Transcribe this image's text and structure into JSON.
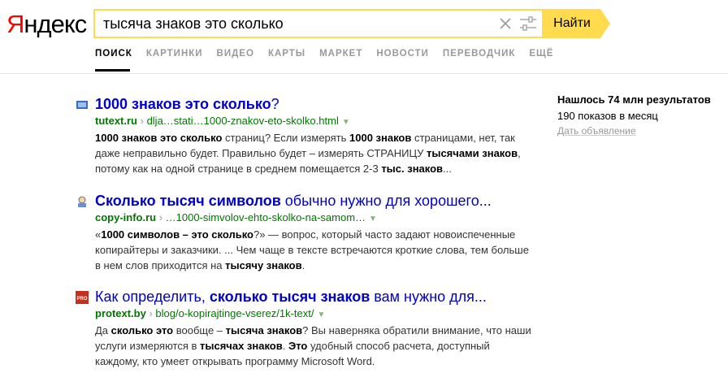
{
  "header": {
    "logo_first": "Я",
    "logo_rest": "ндекс",
    "search_value": "тысяча знаков это сколько",
    "search_button": "Найти"
  },
  "tabs": [
    "ПОИСК",
    "КАРТИНКИ",
    "ВИДЕО",
    "КАРТЫ",
    "МАРКЕТ",
    "НОВОСТИ",
    "ПЕРЕВОДЧИК",
    "ЕЩЁ"
  ],
  "results": [
    {
      "title_segments": [
        {
          "t": "1000 знаков это сколько",
          "b": true
        },
        {
          "t": "?",
          "b": false
        }
      ],
      "host": "tutext.ru",
      "path": "dlja…stati…1000-znakov-eto-skolko.html",
      "snippet_segments": [
        {
          "t": "1000 знаков это сколько",
          "b": true
        },
        {
          "t": " страниц? Если измерять ",
          "b": false
        },
        {
          "t": "1000 знаков",
          "b": true
        },
        {
          "t": " страницами, нет, так даже неправильно будет. Правильно будет – измерять СТРАНИЦУ ",
          "b": false
        },
        {
          "t": "тысячами знаков",
          "b": true
        },
        {
          "t": ", потому как на одной странице в среднем помещается 2-3 ",
          "b": false
        },
        {
          "t": "тыс. знаков",
          "b": true
        },
        {
          "t": "...",
          "b": false
        }
      ]
    },
    {
      "title_segments": [
        {
          "t": "Сколько тысяч символов",
          "b": true
        },
        {
          "t": " обычно нужно для хорошего...",
          "b": false
        }
      ],
      "host": "copy-info.ru",
      "path": "…1000-simvolov-ehto-skolko-na-samom…",
      "snippet_segments": [
        {
          "t": "«",
          "b": false
        },
        {
          "t": "1000 символов – это сколько",
          "b": true
        },
        {
          "t": "?» — вопрос, который часто задают новоиспеченные копирайтеры и заказчики. ... Чем чаще в тексте встречаются кроткие слова, тем больше в нем слов приходится на ",
          "b": false
        },
        {
          "t": "тысячу знаков",
          "b": true
        },
        {
          "t": ".",
          "b": false
        }
      ]
    },
    {
      "title_segments": [
        {
          "t": "Как определить, ",
          "b": false
        },
        {
          "t": "сколько тысяч знаков",
          "b": true
        },
        {
          "t": " вам нужно для...",
          "b": false
        }
      ],
      "host": "protext.by",
      "path": "blog/o-kopirajtinge-vserez/1k-text/",
      "snippet_segments": [
        {
          "t": "Да ",
          "b": false
        },
        {
          "t": "сколько это",
          "b": true
        },
        {
          "t": " вообще – ",
          "b": false
        },
        {
          "t": "тысяча знаков",
          "b": true
        },
        {
          "t": "? Вы наверняка обратили внимание, что наши услуги измеряются в ",
          "b": false
        },
        {
          "t": "тысячах знаков",
          "b": true
        },
        {
          "t": ". ",
          "b": false
        },
        {
          "t": "Это",
          "b": true
        },
        {
          "t": " удобный способ расчета, доступный каждому, кто умеет открывать программу Microsoft Word.",
          "b": false
        }
      ]
    }
  ],
  "sidebar": {
    "found": "Нашлось 74 млн результатов",
    "shows": "190 показов в месяц",
    "ad": "Дать объявление"
  },
  "colors": {
    "accent": "#ffdb4d",
    "link": "#0000cc",
    "url": "#007700"
  },
  "icons": [
    "clear-icon",
    "tune-icon",
    "favicon-tutext",
    "favicon-copy-info",
    "favicon-protext"
  ]
}
